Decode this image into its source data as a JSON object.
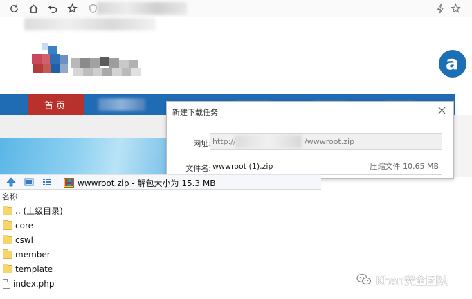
{
  "site": {
    "nav_home": "首页"
  },
  "dialog": {
    "title": "新建下载任务",
    "url_label": "网址:",
    "url_prefix": "http://",
    "url_suffix": "/wwwroot.zip",
    "filename_label": "文件名:",
    "filename": "wwwroot (1).zip",
    "file_size": "压缩文件 10.65 MB"
  },
  "archive": {
    "path": "wwwroot.zip - 解包大小为 15.3 MB",
    "column_name": "名称",
    "items": [
      {
        "name": ".. (上级目录)",
        "type": "folder"
      },
      {
        "name": "core",
        "type": "folder"
      },
      {
        "name": "cswl",
        "type": "folder"
      },
      {
        "name": "member",
        "type": "folder"
      },
      {
        "name": "template",
        "type": "folder"
      },
      {
        "name": "index.php",
        "type": "file"
      }
    ]
  },
  "watermark": {
    "text": "Khan安全团队"
  },
  "colors": {
    "nav_blue": "#1f6cb5",
    "nav_home_red": "#b9312b",
    "folder_yellow": "#f7d56a"
  }
}
